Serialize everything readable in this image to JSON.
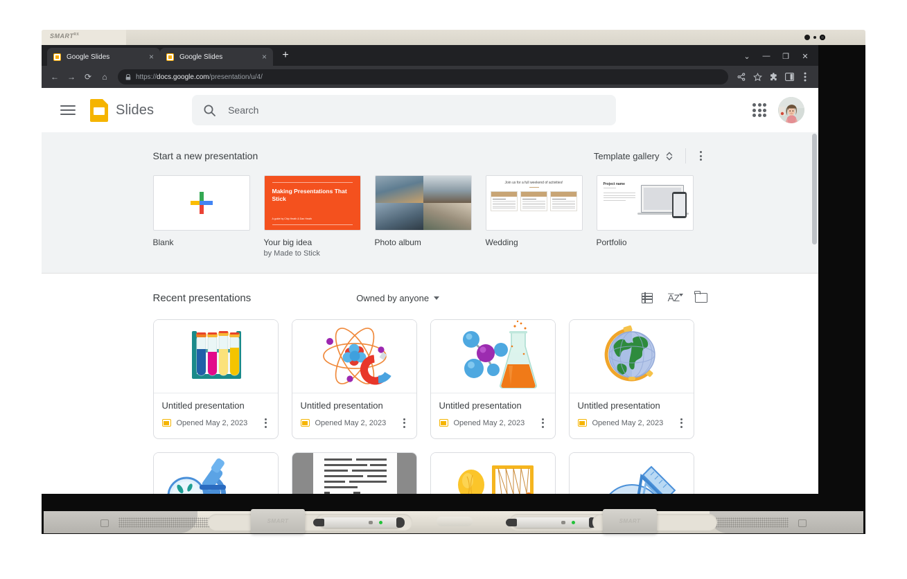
{
  "device": {
    "brand": "SMART",
    "brand_sup": "RX",
    "eraser_label_left": "SMART",
    "eraser_label_right": "SMART"
  },
  "browser": {
    "tabs": [
      {
        "title": "Google Slides",
        "favicon": "slides-favicon",
        "close": "×",
        "active": true
      },
      {
        "title": "Google Slides",
        "favicon": "slides-favicon",
        "close": "×",
        "active": true
      }
    ],
    "new_tab_label": "+",
    "window_controls": [
      {
        "name": "tab-search-chevron",
        "glyph": "⌄"
      },
      {
        "name": "minimize",
        "glyph": "—"
      },
      {
        "name": "maximize",
        "glyph": "❐"
      },
      {
        "name": "close",
        "glyph": "✕"
      }
    ],
    "nav": {
      "back": "←",
      "forward": "→",
      "reload": "⟳",
      "home": "⌂"
    },
    "omnibox": {
      "lock": "🔒",
      "url_prefix": "https://",
      "url_domain": "docs.google.com",
      "url_path": "/presentation/u/4/"
    },
    "toolbar_right": [
      {
        "name": "share-icon",
        "glyph": "≤"
      },
      {
        "name": "bookmark-star-icon",
        "glyph": "☆"
      },
      {
        "name": "extensions-icon",
        "glyph": "⧉"
      },
      {
        "name": "side-panel-icon",
        "glyph": "▣"
      },
      {
        "name": "chrome-menu-icon",
        "glyph": "⋮"
      }
    ]
  },
  "app": {
    "header": {
      "menu_icon": "hamburger-icon",
      "logo_icon": "google-slides-logo",
      "brand_name": "Slides",
      "search_placeholder": "Search",
      "search_value": "",
      "apps_icon": "apps-grid-icon",
      "avatar_name": "user-avatar"
    },
    "templates": {
      "section_title": "Start a new presentation",
      "gallery_label": "Template gallery",
      "gallery_chevrons": "⌃⌄",
      "more_icon": "more-vert-icon",
      "items": [
        {
          "label": "Blank",
          "sub": "",
          "thumb": "blank-plus"
        },
        {
          "label": "Your big idea",
          "sub": "by Made to Stick",
          "thumb": "your-big-idea",
          "slide_title": "Making Presentations That Stick",
          "slide_byline": "A guide by Chip Heath & Dan Heath"
        },
        {
          "label": "Photo album",
          "sub": "",
          "thumb": "photo-album"
        },
        {
          "label": "Wedding",
          "sub": "",
          "thumb": "wedding",
          "slide_title": "Join us for a full weekend of activities!",
          "columns": [
            "Thursday",
            "Friday",
            "Sunday"
          ]
        },
        {
          "label": "Portfolio",
          "sub": "",
          "thumb": "portfolio",
          "slide_title": "Project name"
        }
      ]
    },
    "recent": {
      "section_title": "Recent presentations",
      "owner_filter": "Owned by anyone",
      "list_view_icon": "list-view-icon",
      "sort_icon": "sort-az-icon",
      "folder_icon": "file-picker-folder-icon",
      "cards": [
        {
          "title": "Untitled presentation",
          "date": "Opened May 2, 2023",
          "thumb": "test-tubes"
        },
        {
          "title": "Untitled presentation",
          "date": "Opened May 2, 2023",
          "thumb": "atom-magnet"
        },
        {
          "title": "Untitled presentation",
          "date": "Opened May 2, 2023",
          "thumb": "molecule-flask"
        },
        {
          "title": "Untitled presentation",
          "date": "Opened May 2, 2023",
          "thumb": "globe"
        },
        {
          "title": "",
          "date": "",
          "thumb": "microscope"
        },
        {
          "title": "",
          "date": "",
          "thumb": "document-page"
        },
        {
          "title": "",
          "date": "",
          "thumb": "lightbulb-cradle"
        },
        {
          "title": "",
          "date": "",
          "thumb": "ruler-protractor"
        }
      ]
    }
  },
  "colors": {
    "slides_yellow": "#f5b400",
    "chrome_dark": "#202124",
    "chrome_toolbar": "#35363a",
    "template_orange": "#f4511e",
    "text_primary": "#3c4043",
    "text_secondary": "#5f6368"
  }
}
